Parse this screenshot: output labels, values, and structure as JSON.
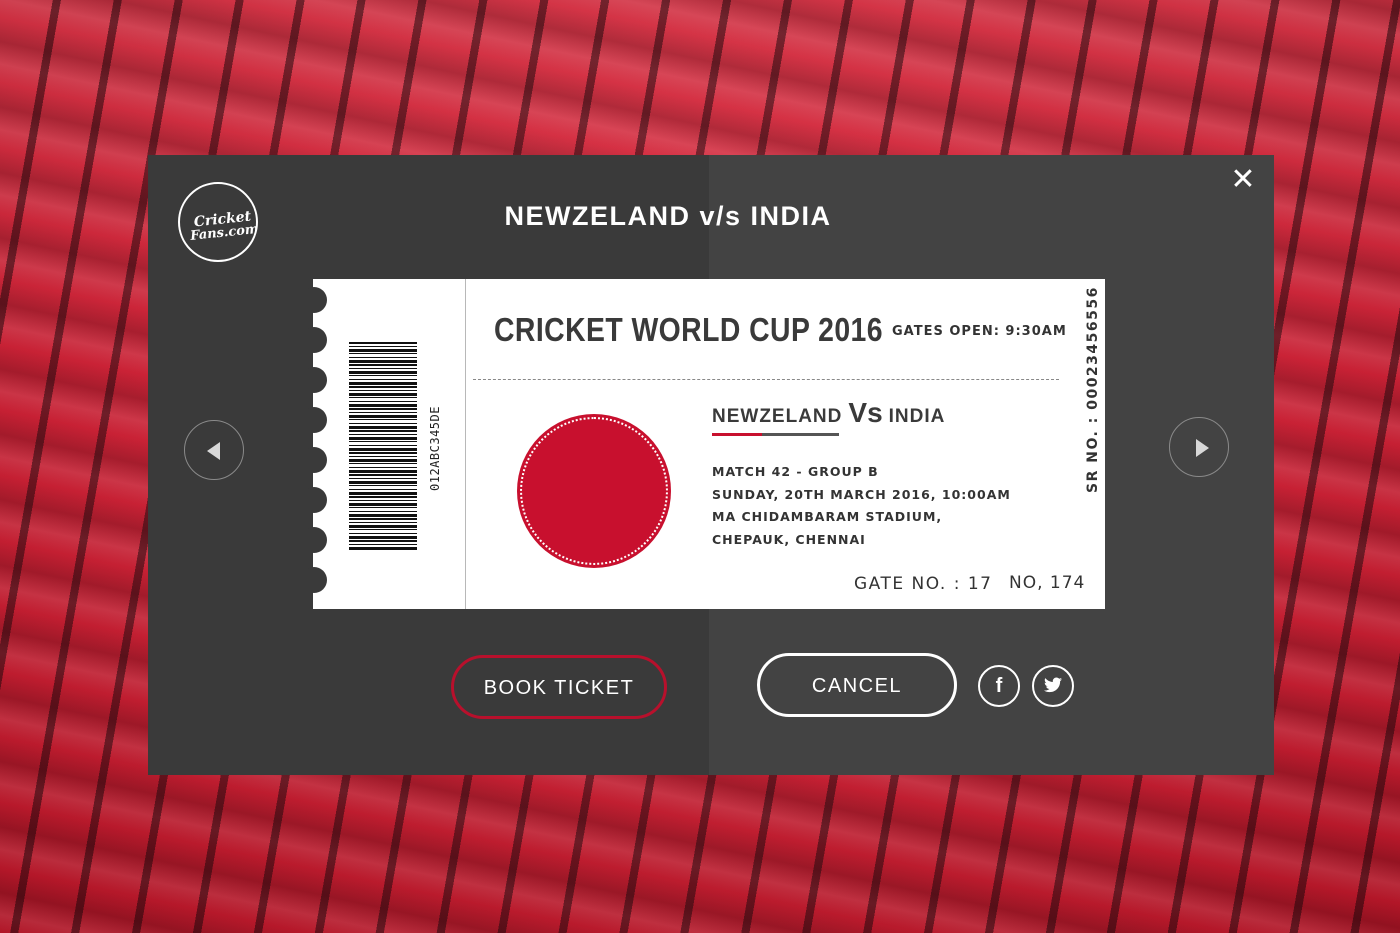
{
  "modal": {
    "title": "NEWZELAND v/s INDIA",
    "close_icon": "✕",
    "logo": {
      "line1": "Cricket",
      "line2": "Fans.com"
    }
  },
  "ticket": {
    "event_title": "CRICKET WORLD CUP 2016",
    "gates_open": "GATES OPEN: 9:30AM",
    "barcode_code": "012ABC345DE",
    "sr_no": "SR NO. : 00023456556",
    "team_a": "NEWZELAND",
    "vs": "Vs",
    "team_b": "INDIA",
    "details": [
      "MATCH 42 - GROUP B",
      "SUNDAY, 20TH MARCH 2016, 10:00AM",
      "MA CHIDAMBARAM STADIUM,",
      "CHEPAUK, CHENNAI"
    ],
    "gate_no": "GATE NO. : 17",
    "seat_no": "NO, 174"
  },
  "actions": {
    "book_label": "BOOK TICKET",
    "cancel_label": "CANCEL",
    "facebook": "f"
  },
  "colors": {
    "accent": "#c8102e",
    "modal_left": "#3a3a3a",
    "modal_right": "#434343"
  }
}
